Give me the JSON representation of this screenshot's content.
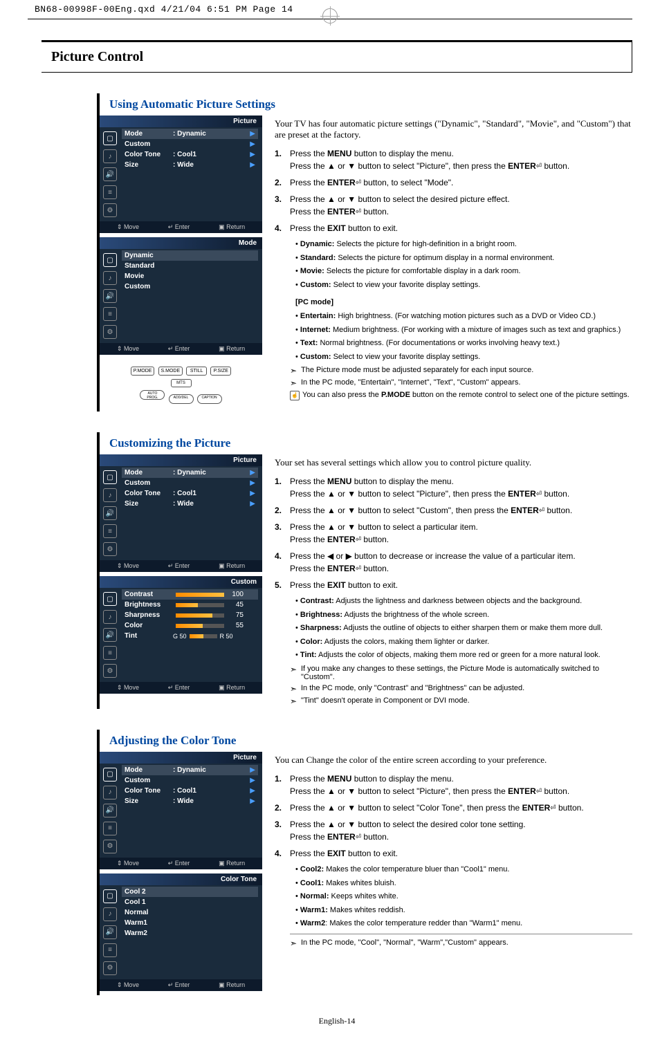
{
  "doc_header": "BN68-00998F-00Eng.qxd  4/21/04  6:51 PM  Page 14",
  "chapter": "Picture Control",
  "footer": "English-14",
  "sec1": {
    "title": "Using Automatic Picture Settings",
    "intro": "Your TV has four automatic picture settings (\"Dynamic\", \"Standard\", \"Movie\", and \"Custom\") that are preset at the factory.",
    "osd1": {
      "title": "Picture",
      "rows": [
        {
          "label": "Mode",
          "val": ": Dynamic"
        },
        {
          "label": "Custom",
          "val": ""
        },
        {
          "label": "Color Tone",
          "val": ": Cool1"
        },
        {
          "label": "Size",
          "val": ": Wide"
        }
      ],
      "footer": {
        "move": "Move",
        "enter": "Enter",
        "ret": "Return"
      }
    },
    "osd2": {
      "title": "Mode",
      "items": [
        "Dynamic",
        "Standard",
        "Movie",
        "Custom"
      ],
      "footer": {
        "move": "Move",
        "enter": "Enter",
        "ret": "Return"
      }
    },
    "remote_labels": [
      "P.MODE",
      "S.MODE",
      "STILL",
      "P.SIZE",
      "MTS",
      "AUTO PROG.",
      "ADD/DEL",
      "CAPTION"
    ],
    "step1a": "Press the ",
    "step1a_b": "MENU",
    "step1a2": " button to display the menu.",
    "step1b": "Press the ▲ or ▼ button to select \"Picture\", then press the ",
    "step1b_b": "ENTER",
    "step1b2": " button.",
    "step2": "Press the ",
    "step2_b": "ENTER",
    "step2b": " button, to select \"Mode\".",
    "step3a": "Press the ▲ or ▼ button to select the desired picture effect.",
    "step3b": "Press the ",
    "step3b_b": "ENTER",
    "step3b2": " button.",
    "step4": "Press the ",
    "step4_b": "EXIT",
    "step4b": " button to exit.",
    "notes_a": [
      {
        "b": "Dynamic:",
        "t": " Selects the picture for high-definition in a bright room."
      },
      {
        "b": "Standard:",
        "t": " Selects the picture for optimum display in a normal environment."
      },
      {
        "b": "Movie:",
        "t": " Selects the picture for comfortable display in a dark room."
      },
      {
        "b": "Custom:",
        "t": " Select to view your favorite display settings."
      }
    ],
    "pc_head": "[PC mode]",
    "notes_b": [
      {
        "b": "Entertain:",
        "t": " High brightness. (For watching motion pictures such as a DVD or Video CD.)"
      },
      {
        "b": "Internet:",
        "t": " Medium brightness. (For working with a mixture of images such as text and graphics.)"
      },
      {
        "b": "Text:",
        "t": " Normal brightness. (For documentations or works involving heavy text.)"
      },
      {
        "b": "Custom:",
        "t": " Select to view your favorite display settings."
      }
    ],
    "hint1": "The Picture mode must be adjusted separately for each input source.",
    "hint2": "In the PC mode, \"Entertain\", \"Internet\", \"Text\", \"Custom\" appears.",
    "pmode_hint_a": "You can also press the ",
    "pmode_hint_b": "P.MODE",
    "pmode_hint_c": " button on the remote control to select one of the picture settings."
  },
  "sec2": {
    "title": "Customizing the Picture",
    "intro": "Your set has several settings which allow you to control picture quality.",
    "osd1": {
      "title": "Picture",
      "rows": [
        {
          "label": "Mode",
          "val": ": Dynamic"
        },
        {
          "label": "Custom",
          "val": ""
        },
        {
          "label": "Color Tone",
          "val": ": Cool1"
        },
        {
          "label": "Size",
          "val": ": Wide"
        }
      ],
      "footer": {
        "move": "Move",
        "enter": "Enter",
        "ret": "Return"
      }
    },
    "osd2": {
      "title": "Custom",
      "rows": [
        {
          "label": "Contrast",
          "val": "100",
          "fill": 100
        },
        {
          "label": "Brightness",
          "val": "45",
          "fill": 45
        },
        {
          "label": "Sharpness",
          "val": "75",
          "fill": 75
        },
        {
          "label": "Color",
          "val": "55",
          "fill": 55
        },
        {
          "label": "Tint",
          "prefix": "G  50",
          "suffix": "R   50",
          "fill": 50
        }
      ],
      "footer": {
        "move": "Move",
        "enter": "Enter",
        "ret": "Return"
      }
    },
    "step1a": "Press the ",
    "step1a_b": "MENU",
    "step1a2": " button to display the menu.",
    "step1b": "Press the ▲ or ▼ button to select \"Picture\", then press the ",
    "step1b_b": "ENTER",
    "step1b2": " button.",
    "step2": "Press the ▲ or ▼ button to select \"Custom\", then press the ",
    "step2_b": "ENTER",
    "step2b": " button.",
    "step3a": "Press the ▲ or ▼ button to select a particular item.",
    "step3b": "Press the ",
    "step3b_b": "ENTER",
    "step3b2": " button.",
    "step4a": "Press the ◀ or ▶ button to decrease or increase the value of a particular item.",
    "step4b": "Press the ",
    "step4b_b": "ENTER",
    "step4b2": " button.",
    "step5": "Press the ",
    "step5_b": "EXIT",
    "step5b": " button to exit.",
    "notes": [
      {
        "b": "Contrast:",
        "t": " Adjusts the lightness and darkness between objects and the background."
      },
      {
        "b": "Brightness:",
        "t": " Adjusts the brightness of the whole screen."
      },
      {
        "b": "Sharpness:",
        "t": " Adjusts the outline of objects to either sharpen them or make them more dull."
      },
      {
        "b": "Color:",
        "t": " Adjusts the colors, making them lighter or darker."
      },
      {
        "b": "Tint:",
        "t": " Adjusts the color of objects, making them more red or green for a more natural look."
      }
    ],
    "hint1": "If you make any changes to these settings, the Picture Mode is automatically switched to \"Custom\".",
    "hint2": "In the PC mode, only \"Contrast\" and \"Brightness\" can be adjusted.",
    "hint3": "\"Tint\" doesn't operate in Component or DVI mode."
  },
  "sec3": {
    "title": "Adjusting the Color Tone",
    "intro": "You can Change the color of the entire screen according to your preference.",
    "osd1": {
      "title": "Picture",
      "rows": [
        {
          "label": "Mode",
          "val": ": Dynamic"
        },
        {
          "label": "Custom",
          "val": ""
        },
        {
          "label": "Color Tone",
          "val": ": Cool1"
        },
        {
          "label": "Size",
          "val": ": Wide"
        }
      ],
      "footer": {
        "move": "Move",
        "enter": "Enter",
        "ret": "Return"
      }
    },
    "osd2": {
      "title": "Color Tone",
      "items": [
        "Cool 2",
        "Cool 1",
        "Normal",
        "Warm1",
        "Warm2"
      ],
      "footer": {
        "move": "Move",
        "enter": "Enter",
        "ret": "Return"
      }
    },
    "step1a": "Press the ",
    "step1a_b": "MENU",
    "step1a2": " button to display the menu.",
    "step1b": "Press the ▲ or ▼ button to select \"Picture\", then press the ",
    "step1b_b": "ENTER",
    "step1b2": " button.",
    "step2": "Press the ▲ or ▼ button to select \"Color Tone\", then press the ",
    "step2_b": "ENTER",
    "step2b": " button.",
    "step3a": "Press the ▲ or ▼ button to select the desired color tone setting.",
    "step3b": "Press the ",
    "step3b_b": "ENTER",
    "step3b2": " button.",
    "step4": "Press the ",
    "step4_b": "EXIT",
    "step4b": " button to exit.",
    "notes": [
      {
        "b": "Cool2:",
        "t": " Makes the color temperature bluer than \"Cool1\" menu."
      },
      {
        "b": "Cool1:",
        "t": " Makes whites bluish."
      },
      {
        "b": "Normal:",
        "t": " Keeps whites white."
      },
      {
        "b": "Warm1:",
        "t": " Makes whites reddish."
      },
      {
        "b": "Warm2",
        "t": ": Makes the color temperature redder than \"Warm1\" menu."
      }
    ],
    "hint1": "In the PC mode, \"Cool\", \"Normal\", \"Warm\",\"Custom\" appears."
  }
}
